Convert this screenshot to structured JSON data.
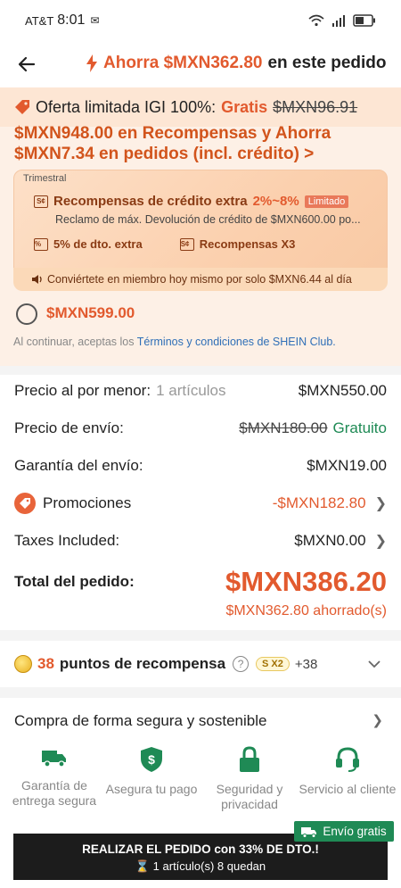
{
  "status": {
    "carrier": "AT&T",
    "time": "8:01",
    "battery": "battery-icon",
    "signal": "signal-icon",
    "wifi": "wifi-icon"
  },
  "header": {
    "prefix": "Ahorra $MXN362.80",
    "suffix": "en este pedido"
  },
  "club": {
    "igi_label": "Oferta limitada IGI 100%:",
    "igi_free": "Gratis",
    "igi_old": "$MXN96.91",
    "headline1": "$MXN948.00 en Recompensas y Ahorra",
    "headline2": "$MXN7.34  en pedidos (incl. crédito) >",
    "period": "Trimestral",
    "reward_title": "Recompensas de crédito extra",
    "reward_pct": "2%~8%",
    "reward_badge": "Limitado",
    "reward_desc": "Reclamo de máx. Devolución de crédito de $MXN600.00 po...",
    "discount": "5% de dto. extra",
    "rewards_x3": "Recompensas X3",
    "banner": "Conviértete en miembro hoy mismo por solo $MXN6.44 al día",
    "price": "$MXN599.00",
    "terms_prefix": "Al continuar, aceptas los",
    "terms_link": "Términos y condiciones de SHEIN Club."
  },
  "summary": {
    "retail_label": "Precio al por menor:",
    "retail_items": "1 artículos",
    "retail_value": "$MXN550.00",
    "shipping_label": "Precio de envío:",
    "shipping_old": "$MXN180.00",
    "shipping_value": "Gratuito",
    "guarantee_label": "Garantía del envío:",
    "guarantee_value": "$MXN19.00",
    "promo_label": "Promociones",
    "promo_value": "-$MXN182.80",
    "taxes_label": "Taxes Included:",
    "taxes_value": "$MXN0.00",
    "total_label": "Total del pedido:",
    "total_value": "$MXN386.20",
    "saved": "$MXN362.80 ahorrado(s)"
  },
  "points": {
    "count": "38",
    "label": "puntos de recompensa",
    "badge": "S X2",
    "plus": "+38"
  },
  "secure": {
    "title": "Compra de forma segura y sostenible",
    "features": [
      {
        "label": "Garantía de entrega segura"
      },
      {
        "label": "Asegura tu pago"
      },
      {
        "label": "Seguridad y privacidad"
      },
      {
        "label": "Servicio al cliente"
      }
    ]
  },
  "bottom": {
    "cta": "REALIZAR EL PEDIDO con 33% DE DTO.!",
    "stock": "1 artículo(s) 8 quedan",
    "free_shipping": "Envío gratis"
  },
  "colors": {
    "accent": "#e25a2e",
    "green": "#1f8a55",
    "dark": "#1c1c1c"
  }
}
